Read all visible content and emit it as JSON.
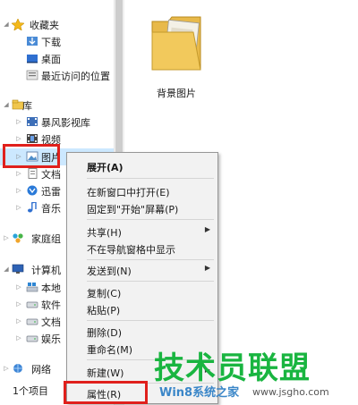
{
  "nav": {
    "favorites": {
      "label": "收藏夹",
      "items": [
        "下载",
        "桌面",
        "最近访问的位置"
      ]
    },
    "libraries": {
      "label": "库",
      "items": [
        "暴风影视库",
        "视频",
        "图片",
        "文档",
        "迅雷",
        "音乐"
      ]
    },
    "homegroup": {
      "label": "家庭组"
    },
    "computer": {
      "label": "计算机",
      "items": [
        "本地",
        "软件",
        "文档",
        "娱乐"
      ]
    },
    "network": {
      "label": "网络"
    }
  },
  "content": {
    "folder_name": "背景图片"
  },
  "context_menu": {
    "items": [
      {
        "label": "展开(A)",
        "bold": true,
        "submenu": false
      },
      {
        "label": "在新窗口中打开(E)",
        "submenu": false
      },
      {
        "label": "固定到\"开始\"屏幕(P)",
        "submenu": false
      },
      {
        "label": "共享(H)",
        "submenu": true
      },
      {
        "label": "不在导航窗格中显示",
        "submenu": false
      },
      {
        "label": "发送到(N)",
        "submenu": true
      },
      {
        "label": "复制(C)",
        "submenu": false
      },
      {
        "label": "粘贴(P)",
        "submenu": false
      },
      {
        "label": "删除(D)",
        "submenu": false
      },
      {
        "label": "重命名(M)",
        "submenu": false
      },
      {
        "label": "新建(W)",
        "submenu": true
      },
      {
        "label": "属性(R)",
        "submenu": false
      }
    ]
  },
  "status": {
    "item_count": "1个项目"
  },
  "watermark": {
    "title": "技术员联盟",
    "subtitle": "Win8系统之家",
    "site": "www.jsgho.com"
  },
  "colors": {
    "highlight_box": "#e0201c",
    "selection": "#cce8ff",
    "watermark_green": "#19b540"
  }
}
